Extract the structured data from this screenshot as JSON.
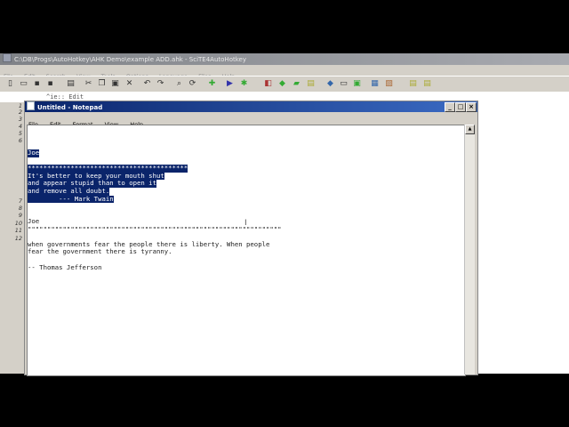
{
  "scite": {
    "title": "C:\\DB\\Progs\\AutoHotkey\\AHK Demo\\example ADD.ahk - SciTE4AutoHotkey",
    "menu": [
      "File",
      "Edit",
      "Search",
      "View",
      "Tools",
      "Options",
      "Language",
      "Files",
      "Help"
    ],
    "toolbar_icons": [
      "new-file-icon",
      "open-folder-icon",
      "save-icon",
      "save-all-icon",
      "print-icon",
      "cut-icon",
      "copy-icon",
      "paste-icon",
      "delete-icon",
      "undo-icon",
      "redo-icon",
      "find-icon",
      "replace-icon",
      "compile-icon",
      "run-icon",
      "debug-icon",
      "tool-1-icon",
      "tool-2-icon",
      "tool-3-icon",
      "tool-4-icon",
      "tool-5-icon",
      "tool-6-icon",
      "tool-7-icon",
      "tool-8-icon",
      "tool-9-icon",
      "tool-10-icon",
      "tool-11-icon"
    ],
    "tab_text": "^ie:: Edit",
    "line_numbers": [
      "1",
      "2",
      "3",
      "4",
      "5",
      "6",
      "7",
      "8",
      "9",
      "10",
      "11",
      "12"
    ]
  },
  "notepad": {
    "title": "Untitled - Notepad",
    "menu": [
      "File",
      "Edit",
      "Format",
      "View",
      "Help"
    ],
    "buttons": {
      "minimize": "_",
      "maximize": "□",
      "close": "×"
    },
    "selected_lines": [
      "Joe",
      "",
      "*****************************************",
      "It's better to keep your mouth shut",
      "and appear stupid than to open it",
      "and remove all doubt.",
      "        --- Mark Twain"
    ],
    "plain_lines": [
      "Joe",
      "\"\"\"\"\"\"\"\"\"\"\"\"\"\"\"\"\"\"\"\"\"\"\"\"\"\"\"\"\"\"\"\"\"\"\"\"\"\"\"\"\"\"\"\"\"\"\"\"\"\"\"\"\"\"\"\"\"\"\"\"\"\"\"\"\"",
      "",
      "when governments fear the people there is liberty. When people",
      "fear the government there is tyranny.",
      "",
      "-- Thomas Jefferson"
    ],
    "cursor_glyph": "I"
  }
}
